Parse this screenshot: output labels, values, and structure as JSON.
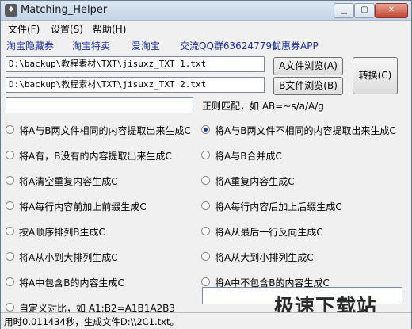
{
  "window": {
    "title": "Matching_Helper"
  },
  "menu": [
    "文件(F)",
    "设置(S)",
    "帮助(H)"
  ],
  "links": [
    "淘宝隐藏券",
    "淘宝特卖",
    "爱淘宝",
    "交流QQ群636247791",
    "优惠券APP"
  ],
  "file_a": {
    "path": "D:\\backup\\教程素材\\TXT\\jisuxz_TXT 1.txt",
    "browse_label": "A文件浏览(A)"
  },
  "file_b": {
    "path": "D:\\backup\\教程素材\\TXT\\jisuxz_TXT 2.txt",
    "browse_label": "B文件浏览(B)"
  },
  "convert_label": "转换(C)",
  "regex": {
    "value": "",
    "hint": "正则匹配，如 AB=~s/a/A/g"
  },
  "options": {
    "left": [
      "将A与B两文件相同的内容提取出来生成C",
      "将A有，B没有的内容提取出来生成C",
      "将A清空重复内容生成C",
      "将A每行内容前加上前缀生成C",
      "按A顺序排列B生成C",
      "将A从小到大排列生成C",
      "将A中包含B的内容生成C",
      "自定义对比，如 A1:B2=A1B1A2B3"
    ],
    "right": [
      "将A与B两文件不相同的内容提取出来生成C",
      "将A与B合并成C",
      "将A重复内容生成C",
      "将A每行内容后加上后缀生成C",
      "将A从最后一行反向生成C",
      "将A从大到小排列生成C",
      "将A中不包含B的内容生成C"
    ],
    "selected": "将A与B两文件不相同的内容提取出来生成C"
  },
  "custom_input": {
    "value": ""
  },
  "status": "用时0.011434秒，生成文件D:\\\\2C1.txt。",
  "watermark": "极速下载站"
}
